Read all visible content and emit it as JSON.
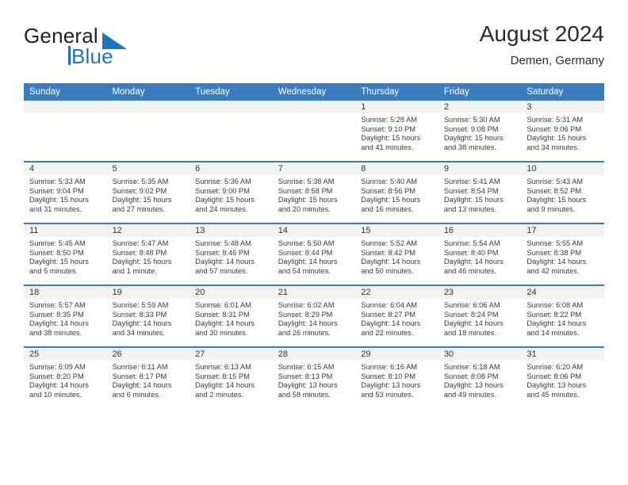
{
  "brand": {
    "word1": "General",
    "word2": "Blue",
    "logo_icon": "blue-triangle-icon",
    "accent_color": "#1b76bc"
  },
  "header": {
    "month_title": "August 2024",
    "location": "Demen, Germany"
  },
  "theme": {
    "header_blue": "#3b7cbf",
    "daynum_gray": "#f2f2f2",
    "text": "#3a3a3a"
  },
  "calendar": {
    "weekday_headers": [
      "Sunday",
      "Monday",
      "Tuesday",
      "Wednesday",
      "Thursday",
      "Friday",
      "Saturday"
    ],
    "weeks": [
      [
        {
          "day": "",
          "lines": []
        },
        {
          "day": "",
          "lines": []
        },
        {
          "day": "",
          "lines": []
        },
        {
          "day": "",
          "lines": []
        },
        {
          "day": "1",
          "lines": [
            "Sunrise: 5:28 AM",
            "Sunset: 9:10 PM",
            "Daylight: 15 hours",
            "and 41 minutes."
          ]
        },
        {
          "day": "2",
          "lines": [
            "Sunrise: 5:30 AM",
            "Sunset: 9:08 PM",
            "Daylight: 15 hours",
            "and 38 minutes."
          ]
        },
        {
          "day": "3",
          "lines": [
            "Sunrise: 5:31 AM",
            "Sunset: 9:06 PM",
            "Daylight: 15 hours",
            "and 34 minutes."
          ]
        }
      ],
      [
        {
          "day": "4",
          "lines": [
            "Sunrise: 5:33 AM",
            "Sunset: 9:04 PM",
            "Daylight: 15 hours",
            "and 31 minutes."
          ]
        },
        {
          "day": "5",
          "lines": [
            "Sunrise: 5:35 AM",
            "Sunset: 9:02 PM",
            "Daylight: 15 hours",
            "and 27 minutes."
          ]
        },
        {
          "day": "6",
          "lines": [
            "Sunrise: 5:36 AM",
            "Sunset: 9:00 PM",
            "Daylight: 15 hours",
            "and 24 minutes."
          ]
        },
        {
          "day": "7",
          "lines": [
            "Sunrise: 5:38 AM",
            "Sunset: 8:58 PM",
            "Daylight: 15 hours",
            "and 20 minutes."
          ]
        },
        {
          "day": "8",
          "lines": [
            "Sunrise: 5:40 AM",
            "Sunset: 8:56 PM",
            "Daylight: 15 hours",
            "and 16 minutes."
          ]
        },
        {
          "day": "9",
          "lines": [
            "Sunrise: 5:41 AM",
            "Sunset: 8:54 PM",
            "Daylight: 15 hours",
            "and 13 minutes."
          ]
        },
        {
          "day": "10",
          "lines": [
            "Sunrise: 5:43 AM",
            "Sunset: 8:52 PM",
            "Daylight: 15 hours",
            "and 9 minutes."
          ]
        }
      ],
      [
        {
          "day": "11",
          "lines": [
            "Sunrise: 5:45 AM",
            "Sunset: 8:50 PM",
            "Daylight: 15 hours",
            "and 5 minutes."
          ]
        },
        {
          "day": "12",
          "lines": [
            "Sunrise: 5:47 AM",
            "Sunset: 8:48 PM",
            "Daylight: 15 hours",
            "and 1 minute."
          ]
        },
        {
          "day": "13",
          "lines": [
            "Sunrise: 5:48 AM",
            "Sunset: 8:46 PM",
            "Daylight: 14 hours",
            "and 57 minutes."
          ]
        },
        {
          "day": "14",
          "lines": [
            "Sunrise: 5:50 AM",
            "Sunset: 8:44 PM",
            "Daylight: 14 hours",
            "and 54 minutes."
          ]
        },
        {
          "day": "15",
          "lines": [
            "Sunrise: 5:52 AM",
            "Sunset: 8:42 PM",
            "Daylight: 14 hours",
            "and 50 minutes."
          ]
        },
        {
          "day": "16",
          "lines": [
            "Sunrise: 5:54 AM",
            "Sunset: 8:40 PM",
            "Daylight: 14 hours",
            "and 46 minutes."
          ]
        },
        {
          "day": "17",
          "lines": [
            "Sunrise: 5:55 AM",
            "Sunset: 8:38 PM",
            "Daylight: 14 hours",
            "and 42 minutes."
          ]
        }
      ],
      [
        {
          "day": "18",
          "lines": [
            "Sunrise: 5:57 AM",
            "Sunset: 8:35 PM",
            "Daylight: 14 hours",
            "and 38 minutes."
          ]
        },
        {
          "day": "19",
          "lines": [
            "Sunrise: 5:59 AM",
            "Sunset: 8:33 PM",
            "Daylight: 14 hours",
            "and 34 minutes."
          ]
        },
        {
          "day": "20",
          "lines": [
            "Sunrise: 6:01 AM",
            "Sunset: 8:31 PM",
            "Daylight: 14 hours",
            "and 30 minutes."
          ]
        },
        {
          "day": "21",
          "lines": [
            "Sunrise: 6:02 AM",
            "Sunset: 8:29 PM",
            "Daylight: 14 hours",
            "and 26 minutes."
          ]
        },
        {
          "day": "22",
          "lines": [
            "Sunrise: 6:04 AM",
            "Sunset: 8:27 PM",
            "Daylight: 14 hours",
            "and 22 minutes."
          ]
        },
        {
          "day": "23",
          "lines": [
            "Sunrise: 6:06 AM",
            "Sunset: 8:24 PM",
            "Daylight: 14 hours",
            "and 18 minutes."
          ]
        },
        {
          "day": "24",
          "lines": [
            "Sunrise: 6:08 AM",
            "Sunset: 8:22 PM",
            "Daylight: 14 hours",
            "and 14 minutes."
          ]
        }
      ],
      [
        {
          "day": "25",
          "lines": [
            "Sunrise: 6:09 AM",
            "Sunset: 8:20 PM",
            "Daylight: 14 hours",
            "and 10 minutes."
          ]
        },
        {
          "day": "26",
          "lines": [
            "Sunrise: 6:11 AM",
            "Sunset: 8:17 PM",
            "Daylight: 14 hours",
            "and 6 minutes."
          ]
        },
        {
          "day": "27",
          "lines": [
            "Sunrise: 6:13 AM",
            "Sunset: 8:15 PM",
            "Daylight: 14 hours",
            "and 2 minutes."
          ]
        },
        {
          "day": "28",
          "lines": [
            "Sunrise: 6:15 AM",
            "Sunset: 8:13 PM",
            "Daylight: 13 hours",
            "and 58 minutes."
          ]
        },
        {
          "day": "29",
          "lines": [
            "Sunrise: 6:16 AM",
            "Sunset: 8:10 PM",
            "Daylight: 13 hours",
            "and 53 minutes."
          ]
        },
        {
          "day": "30",
          "lines": [
            "Sunrise: 6:18 AM",
            "Sunset: 8:08 PM",
            "Daylight: 13 hours",
            "and 49 minutes."
          ]
        },
        {
          "day": "31",
          "lines": [
            "Sunrise: 6:20 AM",
            "Sunset: 8:06 PM",
            "Daylight: 13 hours",
            "and 45 minutes."
          ]
        }
      ]
    ]
  }
}
